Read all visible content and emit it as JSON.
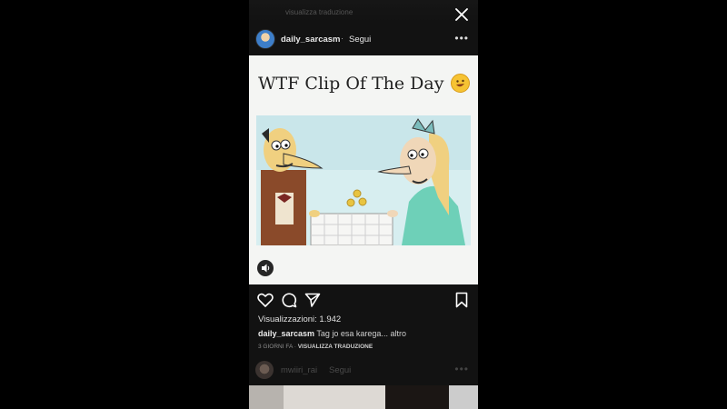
{
  "post": {
    "username": "daily_sarcasm",
    "separator": "·",
    "follow_label": "Segui",
    "more_label": "•••",
    "media_title": "WTF Clip Of The Day",
    "views": "Visualizzazioni: 1.942",
    "caption_user": "daily_sarcasm",
    "caption_text": "Tag jo esa karega... altro",
    "time_ago": "3 GIORNI FA",
    "time_sep": " · ",
    "translate_label": "VISUALIZZA TRADUZIONE"
  },
  "next_post": {
    "username": "mwiiri_rai",
    "follow_label": "Segui",
    "more_label": "•••"
  },
  "top_faded_text": "visualizza traduzione",
  "icons": [
    "close-icon",
    "avatar",
    "more-icon",
    "mute-icon",
    "like-icon",
    "comment-icon",
    "share-icon",
    "bookmark-icon"
  ],
  "colors": {
    "background": "#000000",
    "panel": "#121212",
    "media_bg": "#f4f5f3"
  }
}
